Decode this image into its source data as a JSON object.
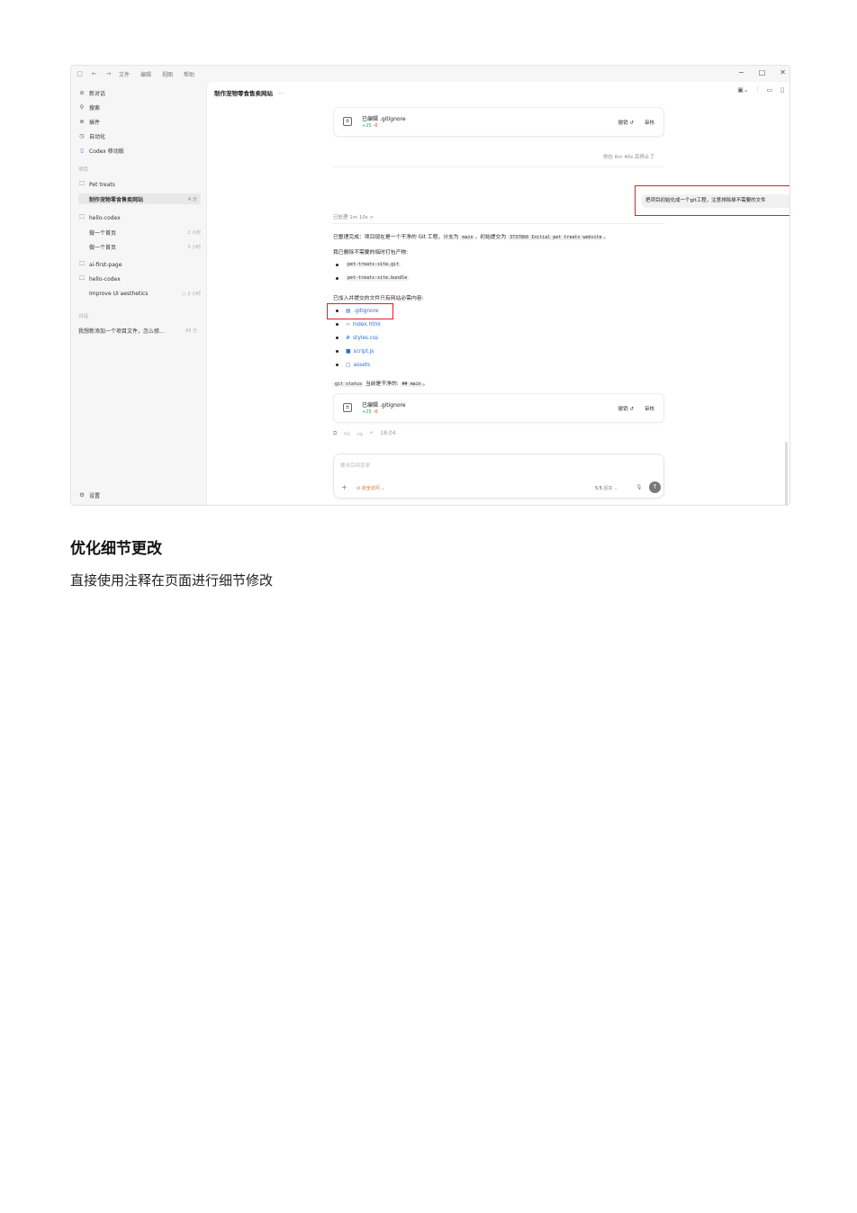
{
  "titlebar": {
    "menus": [
      "文件",
      "编辑",
      "视图",
      "帮助"
    ]
  },
  "sidebar": {
    "top_items": [
      {
        "icon": "new-chat-icon",
        "label": "新对话"
      },
      {
        "icon": "search-icon",
        "label": "搜索"
      },
      {
        "icon": "plugin-icon",
        "label": "插件"
      },
      {
        "icon": "clock-icon",
        "label": "自动化"
      },
      {
        "icon": "mobile-icon",
        "label": "Codex 移动版"
      }
    ],
    "projects_label": "项目",
    "projects": [
      {
        "name": "Pet treats",
        "threads": [
          {
            "title": "制作宠物零食售卖网站",
            "time": "4 分",
            "active": true
          }
        ]
      },
      {
        "name": "hello-codex",
        "threads": [
          {
            "title": "做一个首页",
            "time": "2 小时"
          },
          {
            "title": "做一个首页",
            "time": "3 小时"
          }
        ]
      },
      {
        "name": "ai-first-page",
        "threads": []
      },
      {
        "name": "hello-codex",
        "threads": [
          {
            "title": "Improve UI aesthetics",
            "time": "2 小时"
          }
        ]
      }
    ],
    "chats_label": "对话",
    "chats": [
      {
        "title": "我想新添加一个项目文件，怎么修...",
        "time": "43 分"
      }
    ],
    "settings_label": "设置"
  },
  "main": {
    "title": "制作宠物零食售卖网站",
    "title_more": "···",
    "edit_card": {
      "name": "已编辑 .gitignore",
      "added": "+25",
      "removed": "-0",
      "undo": "撤销 ↺",
      "review": "审核"
    },
    "stopped": "你在 6m 40s 后停止了",
    "user_message": "把项目初始化成一个git工程，注意排除掉不需要的文件",
    "processed": "已处理 1m 10s  >",
    "summary_pre": "已整理完成：项目现在是一个干净的 Git 工程，分支为",
    "summary_branch": "main",
    "summary_mid": "，初始提交为",
    "summary_commit": "3737866 Initial pet treats website",
    "summary_end": "。",
    "removed_intro": "我已删除不需要的临时打包产物:",
    "removed_files": [
      "pet-treats-site.git",
      "pet-treats-site.bundle"
    ],
    "added_intro": "已加入并提交的文件只有网站必需内容:",
    "added_files": [
      {
        "icon": "file-icon",
        "glyph": "▤",
        "name": ".gitignore"
      },
      {
        "icon": "code-icon",
        "glyph": "‹›",
        "name": "index.html"
      },
      {
        "icon": "hash-icon",
        "glyph": "#",
        "name": "styles.css"
      },
      {
        "icon": "js-icon",
        "glyph": "■",
        "name": "script.js"
      },
      {
        "icon": "folder-icon",
        "glyph": "▢",
        "name": "assets"
      }
    ],
    "status_cmd": "git status",
    "status_mid": "当前是干净的:",
    "status_out": "## main",
    "status_end": "。",
    "reaction_time": "18:04",
    "composer": {
      "placeholder": "要求后续变更",
      "access": "⊘ 完全访问 ⌄",
      "model": "5.5",
      "model_level": "超高 ⌄"
    }
  },
  "doc": {
    "heading": "优化细节更改",
    "paragraph": "直接使用注释在页面进行细节修改"
  }
}
